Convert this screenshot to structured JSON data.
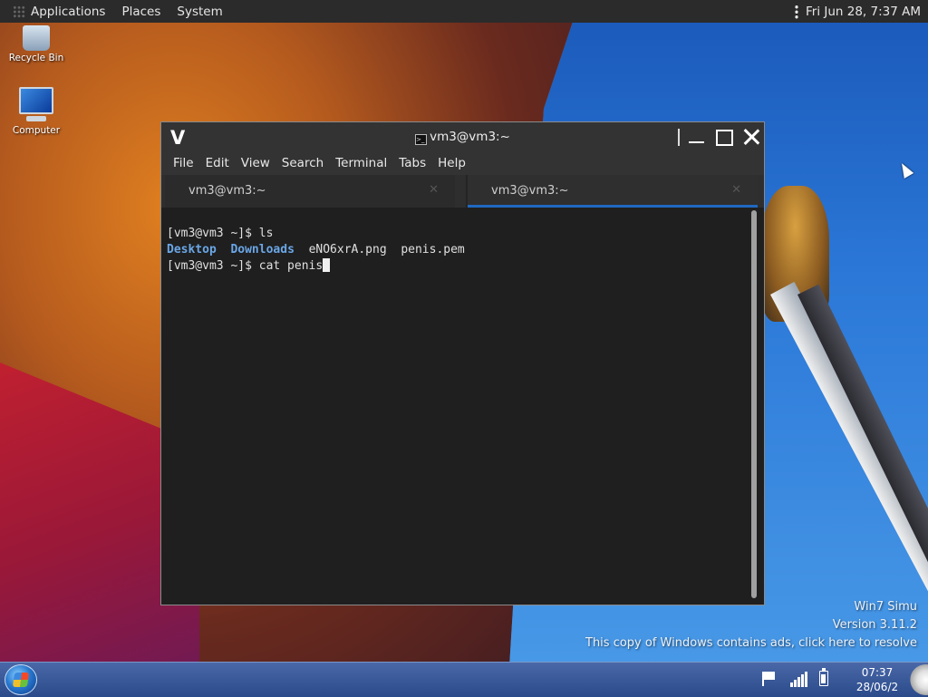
{
  "topbar": {
    "menus": [
      "Applications",
      "Places",
      "System"
    ],
    "clock": "Fri Jun 28,  7:37 AM"
  },
  "desktop_icons": [
    {
      "label": "Recycle Bin",
      "icon": "recycle-bin-icon"
    },
    {
      "label": "Computer",
      "icon": "computer-icon"
    }
  ],
  "terminal_window": {
    "title": "vm3@vm3:~",
    "menus": [
      "File",
      "Edit",
      "View",
      "Search",
      "Terminal",
      "Tabs",
      "Help"
    ],
    "tabs": [
      {
        "label": "vm3@vm3:~",
        "active": false
      },
      {
        "label": "vm3@vm3:~",
        "active": true
      }
    ],
    "lines": {
      "line1": "[vm3@vm3 ~]$ ls",
      "dir1": "Desktop",
      "dir2": "Downloads",
      "file1": "eNO6xrA.png",
      "file2": "penis.pem",
      "line3": "[vm3@vm3 ~]$ cat penis"
    }
  },
  "watermark": {
    "line1": "Win7 Simu",
    "line2": "Version 3.11.2",
    "line3": "This copy of Windows contains ads, click here to resolve"
  },
  "taskbar": {
    "time": "07:37",
    "date": "28/06/2"
  },
  "colors": {
    "terminal_bg": "#1f1f1f",
    "directory_text": "#6aa6e6",
    "active_tab_accent": "#1f68c0",
    "taskbar": "#2a4a8a"
  }
}
